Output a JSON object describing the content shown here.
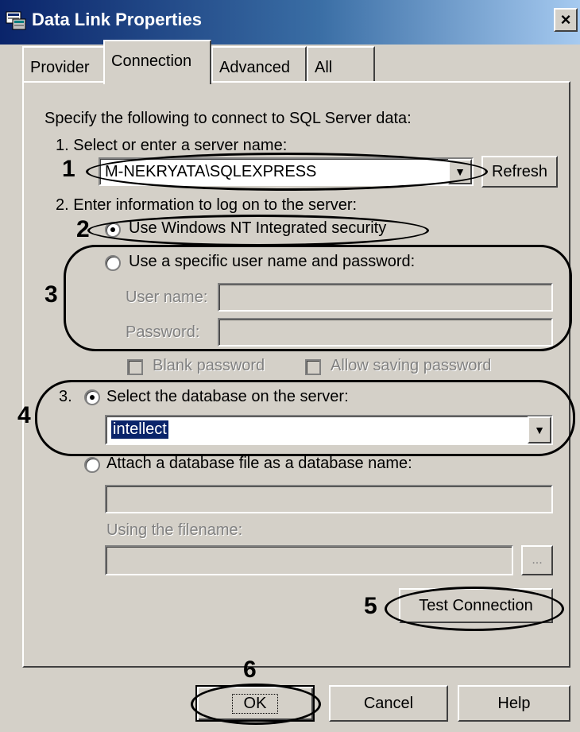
{
  "window": {
    "title": "Data Link Properties",
    "close_label": "×"
  },
  "tabs": [
    {
      "label": "Provider"
    },
    {
      "label": "Connection"
    },
    {
      "label": "Advanced"
    },
    {
      "label": "All"
    }
  ],
  "connection": {
    "intro": "Specify the following to connect to SQL Server data:",
    "step1_label": "1. Select or enter a server name:",
    "server_name": "M-NEKRYATA\\SQLEXPRESS",
    "refresh_label": "Refresh",
    "step2_label": "2. Enter information to log on to the server:",
    "auth_windows_label": "Use Windows NT Integrated security",
    "auth_specific_label": "Use a specific user name and password:",
    "username_label": "User name:",
    "password_label": "Password:",
    "blank_password_label": "Blank password",
    "allow_saving_label": "Allow saving password",
    "step3_prefix": "3.",
    "select_db_label": "Select the database on the server:",
    "database_value": "intellect",
    "attach_db_label": "Attach a database file as a database name:",
    "using_filename_label": "Using the filename:",
    "browse_label": "...",
    "test_connection_label": "Test Connection"
  },
  "buttons": {
    "ok": "OK",
    "cancel": "Cancel",
    "help": "Help"
  },
  "annotations": [
    "1",
    "2",
    "3",
    "4",
    "5",
    "6"
  ]
}
